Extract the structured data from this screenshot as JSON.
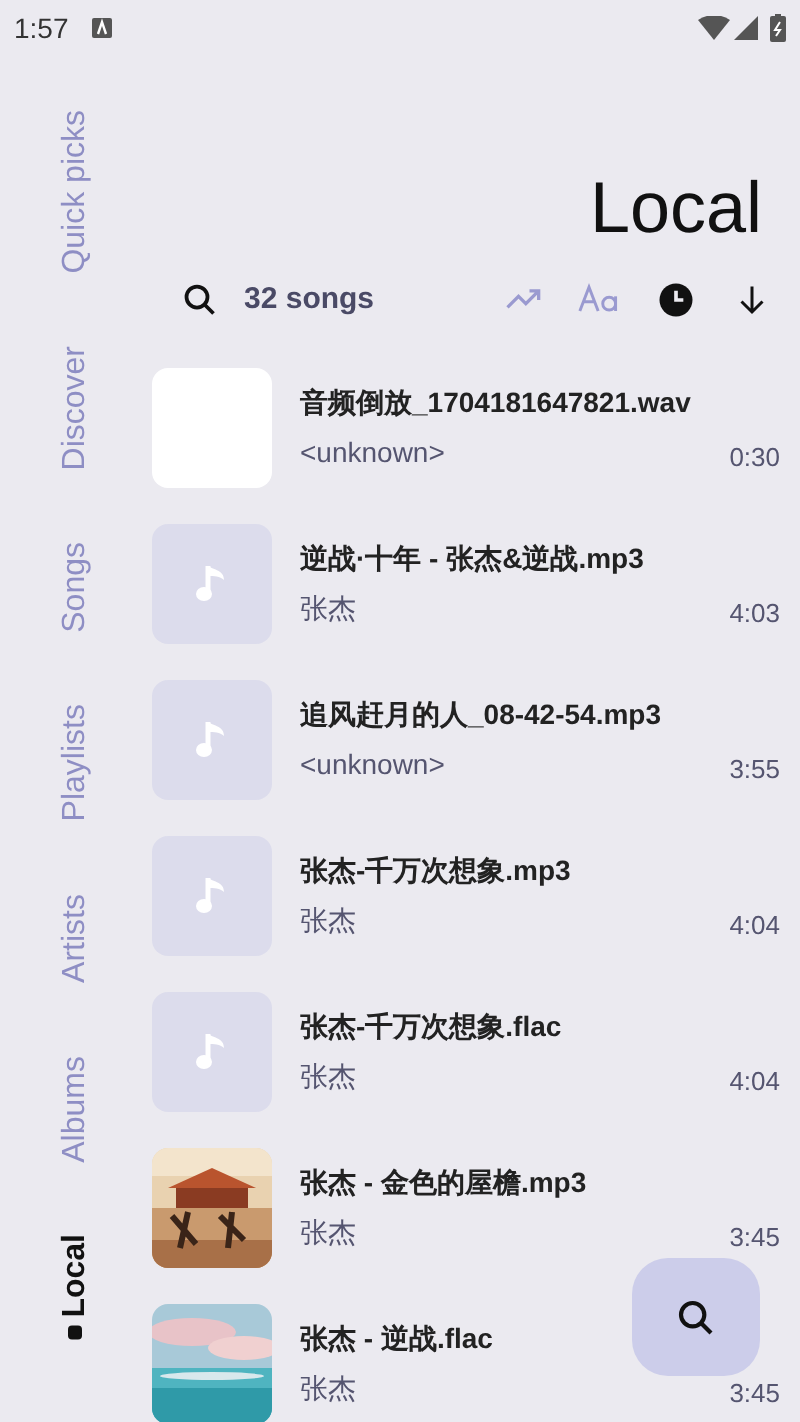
{
  "status_bar": {
    "time": "1:57"
  },
  "nav": [
    {
      "label": "Quick picks",
      "selected": false
    },
    {
      "label": "Discover",
      "selected": false
    },
    {
      "label": "Songs",
      "selected": false
    },
    {
      "label": "Playlists",
      "selected": false
    },
    {
      "label": "Artists",
      "selected": false
    },
    {
      "label": "Albums",
      "selected": false
    },
    {
      "label": "Local",
      "selected": true
    }
  ],
  "header": {
    "title": "Local"
  },
  "toolbar": {
    "count": "32 songs",
    "sort_options": [
      {
        "kind": "trending",
        "selected": false
      },
      {
        "kind": "alphabetical",
        "selected": false
      },
      {
        "kind": "date",
        "selected": true
      }
    ],
    "sort_descending": true
  },
  "songs": [
    {
      "title": "音频倒放_1704181647821.wav",
      "artist": "<unknown>",
      "duration": "0:30",
      "kind": "blank"
    },
    {
      "title": "逆战·十年 - 张杰&逆战.mp3",
      "artist": "张杰",
      "duration": "4:03",
      "kind": "placeholder"
    },
    {
      "title": "追风赶月的人_08-42-54.mp3",
      "artist": "<unknown>",
      "duration": "3:55",
      "kind": "placeholder"
    },
    {
      "title": "张杰-千万次想象.mp3",
      "artist": "张杰",
      "duration": "4:04",
      "kind": "placeholder"
    },
    {
      "title": "张杰-千万次想象.flac",
      "artist": "张杰",
      "duration": "4:04",
      "kind": "placeholder"
    },
    {
      "title": "张杰 - 金色的屋檐.mp3",
      "artist": "张杰",
      "duration": "3:45",
      "kind": "picture"
    },
    {
      "title": "张杰 - 逆战.flac",
      "artist": "张杰",
      "duration": "3:45",
      "kind": "picture"
    }
  ]
}
